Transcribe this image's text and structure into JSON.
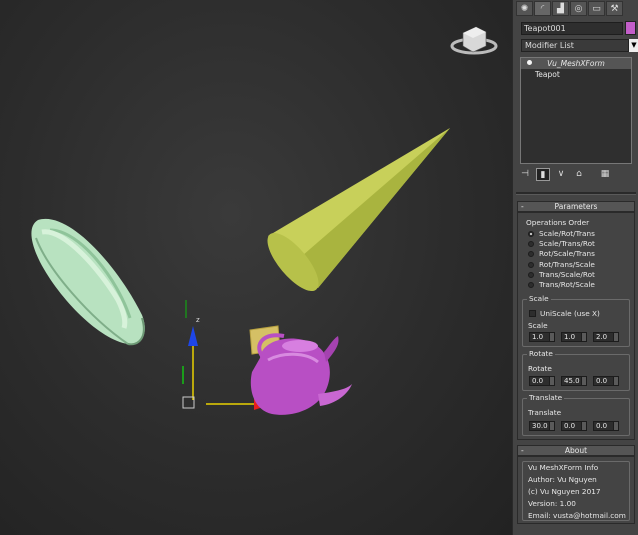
{
  "command_panel": {
    "tabs": [
      {
        "icon": "sun-icon",
        "glyph": "✺"
      },
      {
        "icon": "modify-icon",
        "glyph": "◜"
      },
      {
        "icon": "hierarchy-icon",
        "glyph": "▟"
      },
      {
        "icon": "motion-icon",
        "glyph": "◎"
      },
      {
        "icon": "display-icon",
        "glyph": "▭"
      },
      {
        "icon": "utilities-icon",
        "glyph": "⚒"
      }
    ],
    "object_name": "Teapot001",
    "object_color": "#c35ec9",
    "modifier_list_label": "Modifier List",
    "modifier_stack": [
      "Vu_MeshXForm",
      "Teapot"
    ]
  },
  "parameters": {
    "title": "Parameters",
    "operations_order_label": "Operations Order",
    "operations": [
      "Scale/Rot/Trans",
      "Scale/Trans/Rot",
      "Rot/Scale/Trans",
      "Rot/Trans/Scale",
      "Trans/Scale/Rot",
      "Trans/Rot/Scale"
    ],
    "selected_operation": 0,
    "scale_group": "Scale",
    "uniscale_label": "UniScale (use X)",
    "scale_label": "Scale",
    "scale_values": [
      "1.0",
      "1.0",
      "2.0"
    ],
    "rotate_group": "Rotate",
    "rotate_label": "Rotate",
    "rotate_values": [
      "0.0",
      "45.0",
      "0.0"
    ],
    "translate_group": "Translate",
    "translate_label": "Translate",
    "translate_values": [
      "30.0",
      "0.0",
      "0.0"
    ]
  },
  "about": {
    "title": "About",
    "lines": [
      "Vu MeshXForm Info",
      "Author: Vu Nguyen",
      "(c) Vu Nguyen 2017",
      "Version: 1.00",
      "Email: vusta@hotmail.com"
    ]
  },
  "viewport": {
    "teapot_color": "#b84fc4",
    "cone_color": "#c8d05a",
    "torus_color": "#b8e2c0",
    "gizmo_z_label": "z",
    "gizmo_x_label": "x"
  }
}
